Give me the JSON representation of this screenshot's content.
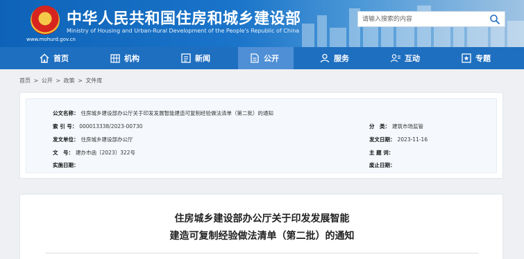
{
  "header": {
    "title": "中华人民共和国住房和城乡建设部",
    "subtitle": "Ministry of Housing and Urban-Rural Development of the People's Republic of China",
    "url": "www.mohurd.gov.cn"
  },
  "search": {
    "placeholder": "请输入搜索的内容"
  },
  "nav": {
    "items": [
      {
        "label": "首页"
      },
      {
        "label": "机构"
      },
      {
        "label": "新闻"
      },
      {
        "label": "公开"
      },
      {
        "label": "服务"
      },
      {
        "label": "互动"
      },
      {
        "label": "专题"
      }
    ],
    "active_index": 3
  },
  "breadcrumb": [
    "首页",
    ">",
    "公开",
    ">",
    "政策",
    ">",
    "文件库"
  ],
  "info": {
    "public_name_label": "公文名称：",
    "public_name_value": "住房城乡建设部办公厅关于印发发展智能建造可复制经验做法清单（第二批）的通知",
    "index_label": "索 引 号：",
    "index_value": "000013338/2023-00730",
    "category_label": "分　类：",
    "category_value": "建筑市场监管",
    "issuer_label": "发文单位：",
    "issuer_value": "住房城乡建设部办公厅",
    "date_label": "发文日期：",
    "date_value": "2023-11-16",
    "docno_label": "文　号：",
    "docno_value": "建办市函〔2023〕322号",
    "subject_label": "主 题 词：",
    "subject_value": "",
    "impl_label": "实施日期：",
    "impl_value": "",
    "repeal_label": "废止日期：",
    "repeal_value": ""
  },
  "article": {
    "title_line1": "住房城乡建设部办公厅关于印发发展智能",
    "title_line2": "建造可复制经验做法清单（第二批）的通知"
  },
  "colors": {
    "header_blue": "#0e63b8",
    "nav_blue": "#1f6fc0",
    "nav_active": "#4f8fd6"
  }
}
